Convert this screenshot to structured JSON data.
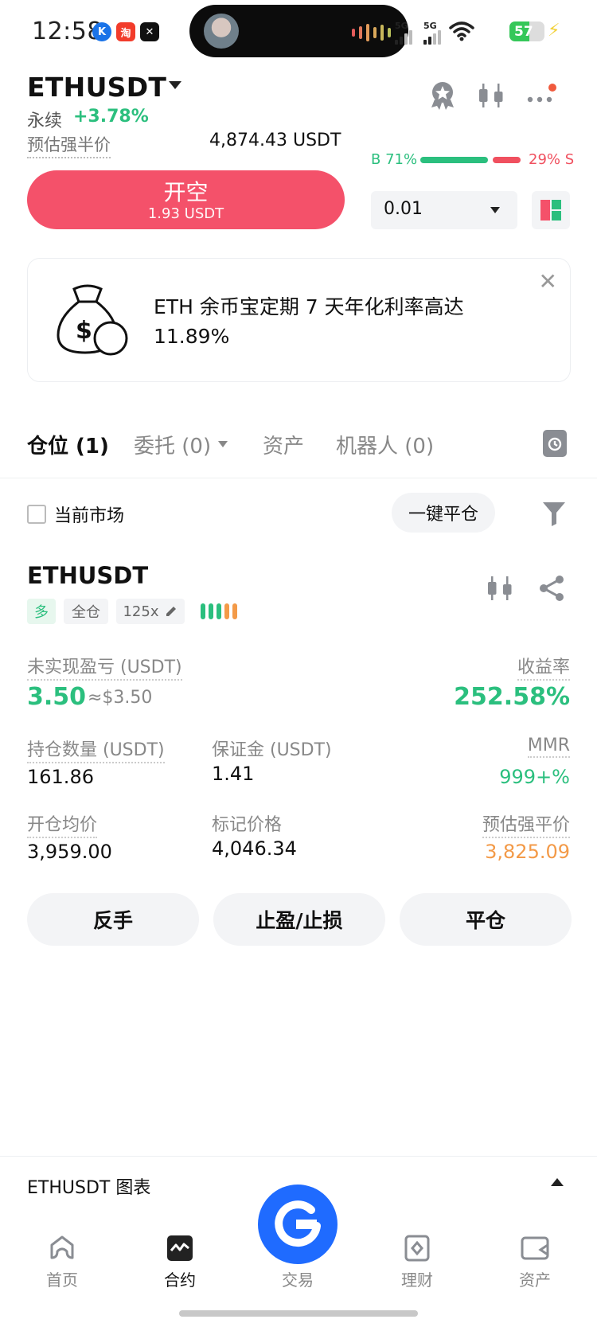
{
  "status_bar": {
    "time": "12:58",
    "net_label_1": "5G",
    "net_label_2": "5G",
    "battery": "57",
    "icons": [
      "app-k-icon",
      "app-taobao-icon",
      "app-capcut-icon",
      "wifi-icon",
      "charging-icon"
    ]
  },
  "header": {
    "pair": "ETHUSDT",
    "contract_type": "永续",
    "change": "+3.78%",
    "liq_label": "预估强半价",
    "liq_value": "4,874.43 USDT",
    "buy_pct_label": "B 71%",
    "sell_pct_label": "29% S",
    "buy_ratio": 0.71
  },
  "order": {
    "button_title": "开空",
    "button_sub": "1.93 USDT",
    "qty": "0.01"
  },
  "promo": {
    "text": "ETH 余币宝定期 7 天年化利率高达 11.89%"
  },
  "tabs": [
    {
      "label": "仓位 (1)"
    },
    {
      "label": "委托 (0)"
    },
    {
      "label": "资产"
    },
    {
      "label": "机器人 (0)"
    }
  ],
  "filters": {
    "current_market": "当前市场",
    "close_all": "一键平仓"
  },
  "position": {
    "symbol": "ETHUSDT",
    "side": "多",
    "margin_mode": "全仓",
    "leverage": "125x",
    "pnl_label": "未实现盈亏 (USDT)",
    "pnl_value": "3.50",
    "pnl_usd": "≈$3.50",
    "roe_label": "收益率",
    "roe_value": "252.58%",
    "size_label": "持仓数量 (USDT)",
    "size_value": "161.86",
    "margin_label": "保证金 (USDT)",
    "margin_value": "1.41",
    "mmr_label": "MMR",
    "mmr_value": "999+%",
    "entry_label": "开仓均价",
    "entry_value": "3,959.00",
    "mark_label": "标记价格",
    "mark_value": "4,046.34",
    "liq_label": "预估强平价",
    "liq_value": "3,825.09"
  },
  "actions": {
    "reverse": "反手",
    "tpsl": "止盈/止损",
    "close": "平仓"
  },
  "chart_panel": {
    "title": "ETHUSDT 图表"
  },
  "bottom_nav": [
    {
      "label": "首页"
    },
    {
      "label": "合约"
    },
    {
      "label": "交易"
    },
    {
      "label": "理财"
    },
    {
      "label": "资产"
    }
  ],
  "colors": {
    "green": "#2bbf7e",
    "red": "#f4516a",
    "orange": "#f39a48",
    "brand_blue": "#1f6bff"
  }
}
